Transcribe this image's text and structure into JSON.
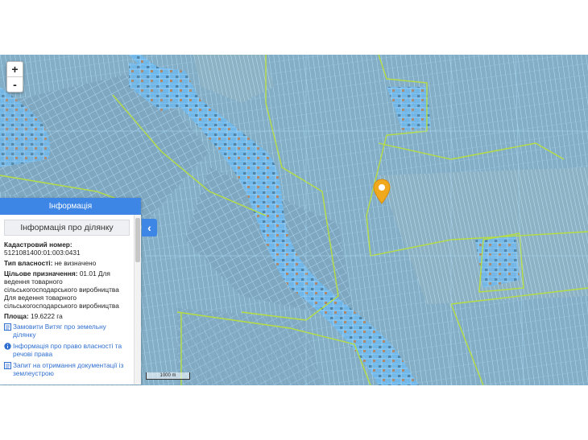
{
  "zoom": {
    "in_label": "+",
    "out_label": "-"
  },
  "panel": {
    "header": "Інформація",
    "subtitle": "Інформація про ділянку",
    "cadastral_label": "Кадастровий номер:",
    "cadastral_value": "5121081400:01:003:0431",
    "ownership_label": "Тип власності:",
    "ownership_value": "не визначено",
    "purpose_label": "Цільове призначення:",
    "purpose_value": "01.01 Для ведення товарного сільськогосподарського виробництва Для ведення товарного сільськогосподарського виробництва",
    "area_label": "Площа:",
    "area_value": "19.6222 га",
    "links": [
      {
        "icon": "document-icon",
        "label": "Замовити Витяг про земельну ділянку"
      },
      {
        "icon": "info-icon",
        "label": "Інформація про право власності та речові права"
      },
      {
        "icon": "document-icon",
        "label": "Запит на отримання документації із землеустрою"
      }
    ]
  },
  "collapse_icon": "chevron-left-icon",
  "scale_label": "1000 m",
  "marker_icon": "map-pin-icon",
  "colors": {
    "parcel_fill": "#6fb8ec",
    "parcel_border": "#8fd4ff",
    "boundary_line": "#b8e03a",
    "marker": "#f0a81c",
    "accent": "#3d86e6"
  }
}
